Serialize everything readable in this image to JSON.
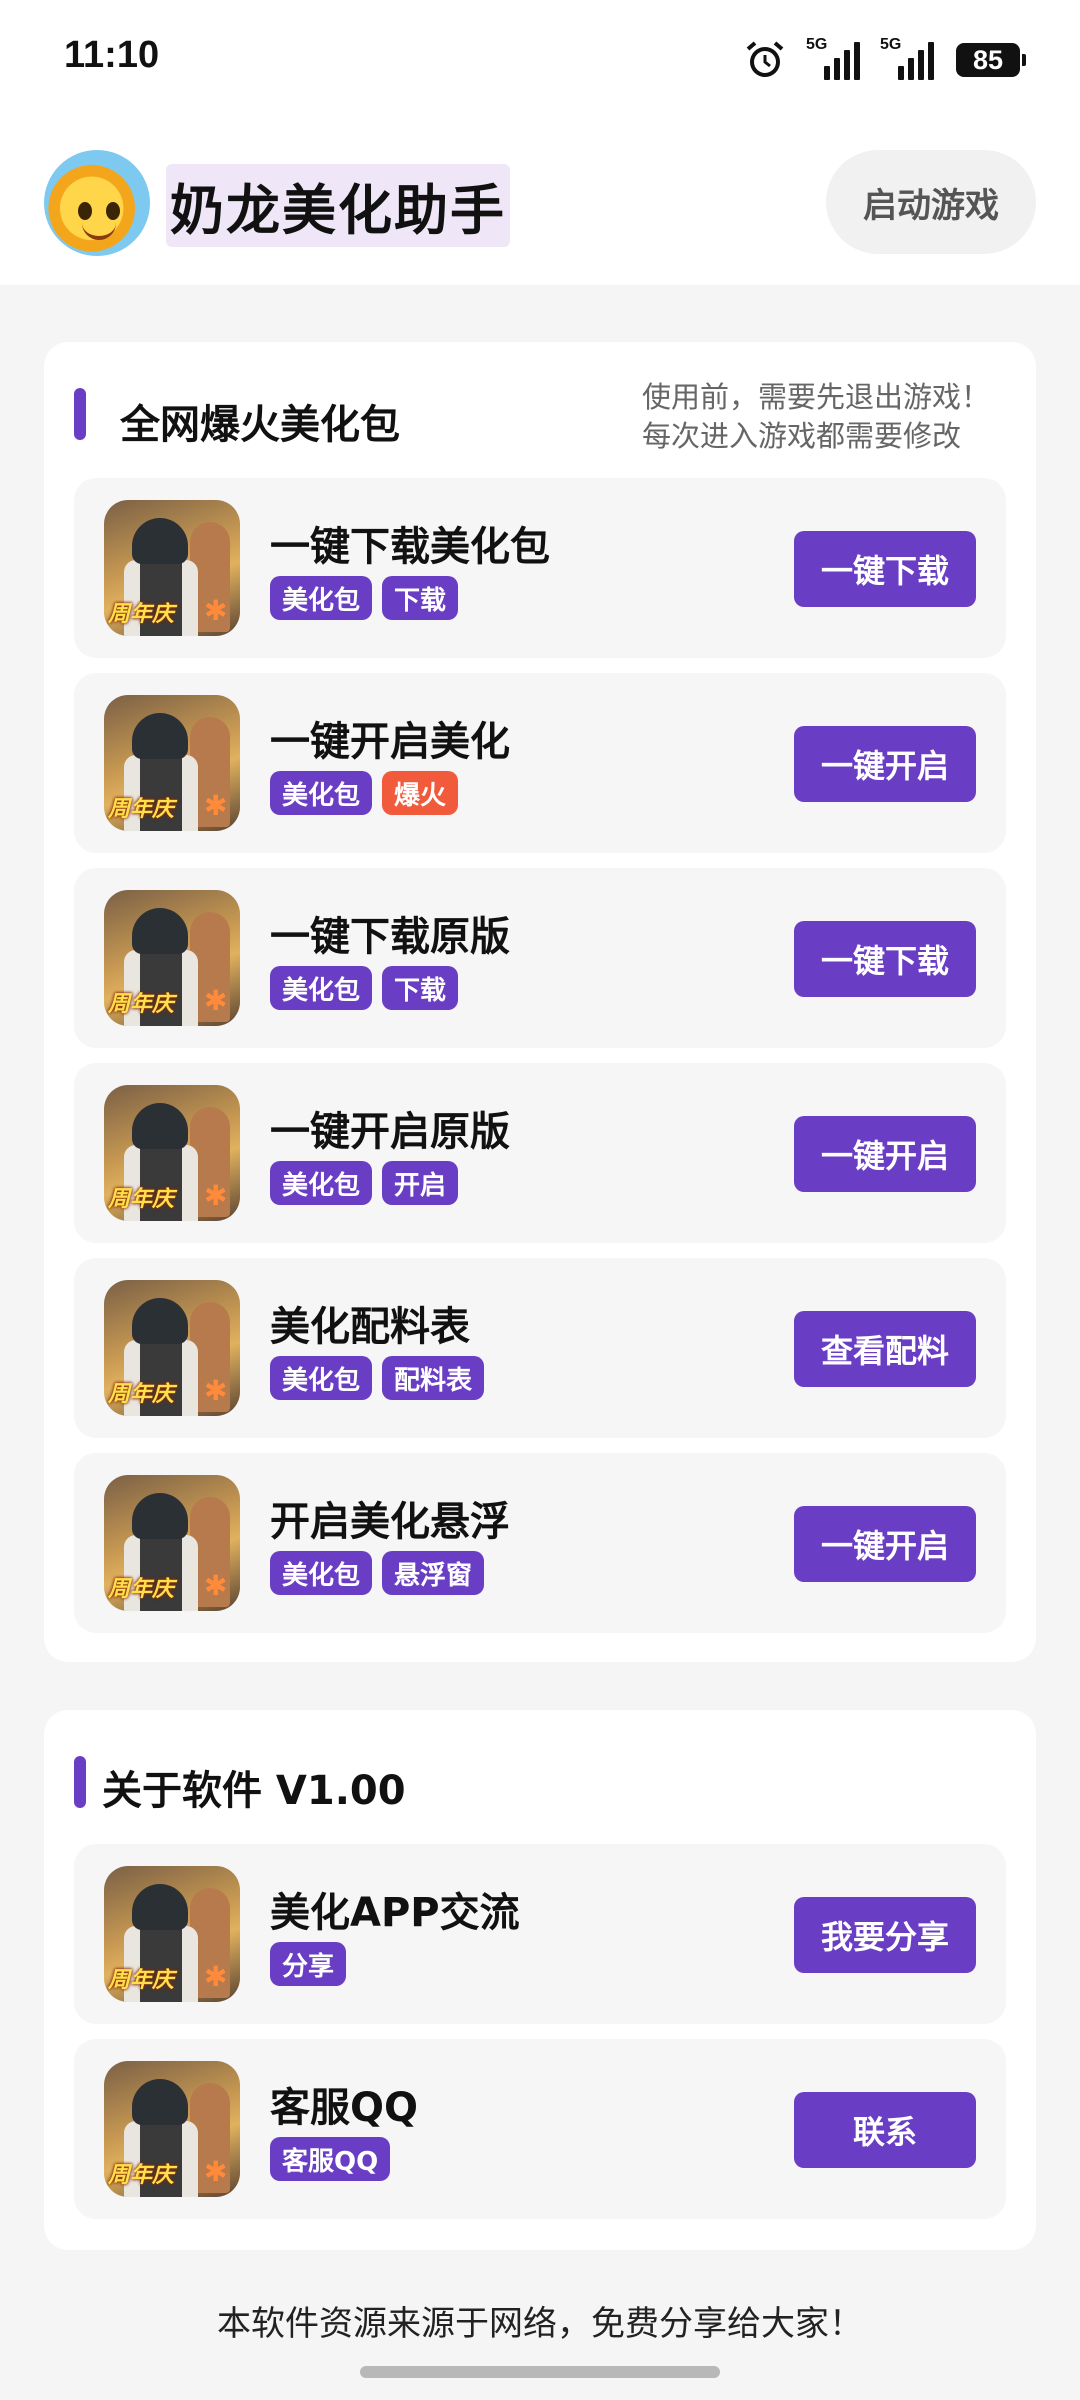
{
  "status_bar": {
    "time": "11:10",
    "signal1_label": "5G",
    "signal2_label": "5G",
    "battery": "85"
  },
  "header": {
    "title": "奶龙美化助手",
    "launch_button": "启动游戏"
  },
  "section1": {
    "title": "全网爆火美化包",
    "note_line1": "使用前，需要先退出游戏！",
    "note_line2": "每次进入游戏都需要修改",
    "thumb_badge": "周年庆",
    "items": [
      {
        "title": "一键下载美化包",
        "tags": [
          "美化包",
          "下载"
        ],
        "button": "一键下载"
      },
      {
        "title": "一键开启美化",
        "tags": [
          "美化包",
          "爆火"
        ],
        "button": "一键开启"
      },
      {
        "title": "一键下载原版",
        "tags": [
          "美化包",
          "下载"
        ],
        "button": "一键下载"
      },
      {
        "title": "一键开启原版",
        "tags": [
          "美化包",
          "开启"
        ],
        "button": "一键开启"
      },
      {
        "title": "美化配料表",
        "tags": [
          "美化包",
          "配料表"
        ],
        "button": "查看配料"
      },
      {
        "title": "开启美化悬浮",
        "tags": [
          "美化包",
          "悬浮窗"
        ],
        "button": "一键开启"
      }
    ]
  },
  "section2": {
    "title": "关于软件 V1.00",
    "items": [
      {
        "title": "美化APP交流",
        "tags": [
          "分享"
        ],
        "button": "我要分享"
      },
      {
        "title": "客服QQ",
        "tags": [
          "客服QQ"
        ],
        "button": "联系"
      }
    ]
  },
  "footer": {
    "text": "本软件资源来源于网络，免费分享给大家！"
  },
  "colors": {
    "accent": "#6a3ec4",
    "hot": "#f25a3c"
  }
}
